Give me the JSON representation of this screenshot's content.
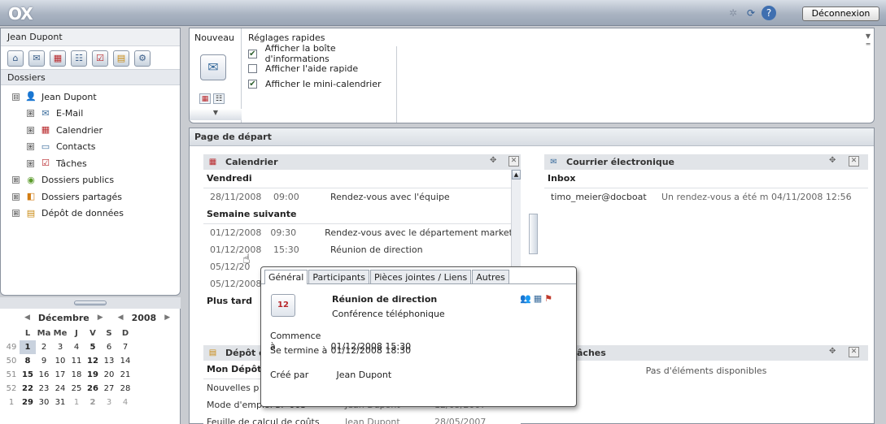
{
  "app": {
    "logo_text": "OX",
    "logout_label": "Déconnexion"
  },
  "topbar_icons": [
    "gear-icon",
    "refresh-icon",
    "help-icon"
  ],
  "sidebar": {
    "user": "Jean Dupont",
    "folders_label": "Dossiers",
    "app_icons": [
      "home-icon",
      "mail-icon",
      "calendar-icon",
      "contacts-icon",
      "tasks-icon",
      "infostore-icon",
      "settings-icon"
    ],
    "tree": [
      {
        "label": "Jean Dupont",
        "expander": "⊟",
        "level": 0,
        "icon": "user-icon",
        "glyph": "👤"
      },
      {
        "label": "E-Mail",
        "expander": "⊞",
        "level": 1,
        "icon": "mail-icon",
        "glyph": "✉"
      },
      {
        "label": "Calendrier",
        "expander": "⊞",
        "level": 1,
        "icon": "calendar-icon",
        "glyph": "▦"
      },
      {
        "label": "Contacts",
        "expander": "⊞",
        "level": 1,
        "icon": "contacts-icon",
        "glyph": "▭"
      },
      {
        "label": "Tâches",
        "expander": "⊞",
        "level": 1,
        "icon": "tasks-icon",
        "glyph": "☑"
      },
      {
        "label": "Dossiers publics",
        "expander": "⊞",
        "level": 0,
        "icon": "public-folders-icon",
        "glyph": "◉"
      },
      {
        "label": "Dossiers partagés",
        "expander": "⊞",
        "level": 0,
        "icon": "shared-folders-icon",
        "glyph": "◧"
      },
      {
        "label": "Dépôt de données",
        "expander": "⊞",
        "level": 0,
        "icon": "infostore-icon",
        "glyph": "▤"
      }
    ]
  },
  "minical": {
    "month": "Décembre",
    "year": "2008",
    "headers": [
      "L",
      "Ma",
      "Me",
      "J",
      "V",
      "S",
      "D"
    ],
    "weeks": [
      {
        "wk": "49",
        "days": [
          "1",
          "2",
          "3",
          "4",
          "5",
          "6",
          "7"
        ]
      },
      {
        "wk": "50",
        "days": [
          "8",
          "9",
          "10",
          "11",
          "12",
          "13",
          "14"
        ]
      },
      {
        "wk": "51",
        "days": [
          "15",
          "16",
          "17",
          "18",
          "19",
          "20",
          "21"
        ]
      },
      {
        "wk": "52",
        "days": [
          "22",
          "23",
          "24",
          "25",
          "26",
          "27",
          "28"
        ]
      },
      {
        "wk": "1",
        "days": [
          "29",
          "30",
          "31",
          "1",
          "2",
          "3",
          "4"
        ]
      }
    ]
  },
  "quick": {
    "new_label": "Nouveau",
    "settings_label": "Réglages rapides",
    "options": [
      {
        "label": "Afficher la boîte d'informations",
        "checked": "✔"
      },
      {
        "label": "Afficher l'aide rapide",
        "checked": ""
      },
      {
        "label": "Afficher le mini-calendrier",
        "checked": "✔"
      }
    ]
  },
  "start": {
    "title": "Page de départ",
    "calendar_widget": {
      "title": "Calendrier",
      "day_label": "Vendredi",
      "day_rows": [
        {
          "date": "28/11/2008",
          "time": "09:00",
          "subject": "Rendez-vous avec l'équipe"
        }
      ],
      "next_week_label": "Semaine suivante",
      "next_week_rows": [
        {
          "date": "01/12/2008",
          "time": "09:30",
          "subject": "Rendez-vous avec le département marketin"
        },
        {
          "date": "01/12/2008",
          "time": "15:30",
          "subject": "Réunion de direction"
        },
        {
          "date": "05/12/20",
          "time": "",
          "subject": ""
        },
        {
          "date": "05/12/2008",
          "time": "",
          "subject": ""
        }
      ],
      "later_label": "Plus tard"
    },
    "mail_widget": {
      "title": "Courrier électronique",
      "folder": "Inbox",
      "from": "timo_meier@docboat",
      "subject": "Un rendez-vous a été m 04/11/2008 12:56"
    },
    "infostore_widget": {
      "title": "Dépôt d",
      "section": "Mon Dépôt d",
      "rows": [
        {
          "name": "Nouvelles p",
          "author": "",
          "date": ""
        },
        {
          "name": "Mode d'emploi SP 003",
          "author": "Jean Dupont",
          "date": "12/05/2007"
        },
        {
          "name": "Feuille de calcul de coûts",
          "author": "Jean Dupont",
          "date": "28/05/2007"
        }
      ]
    },
    "tasks_widget": {
      "title": "âches",
      "empty": "Pas d'éléments disponibles"
    }
  },
  "popup": {
    "tabs": [
      "Général",
      "Participants",
      "Pièces jointes / Liens",
      "Autres"
    ],
    "title": "Réunion de direction",
    "subtitle": "Conférence téléphonique",
    "start_label": "Commence à",
    "start_value": "01/12/2008 15:30",
    "end_label": "Se termine à",
    "end_value": "01/12/2008 18:30",
    "creator_label": "Créé par",
    "creator_value": "Jean Dupont"
  },
  "colors": {
    "header_bg": "#aab4c2",
    "accent": "#3b5e89",
    "flag": "#c0392b"
  }
}
